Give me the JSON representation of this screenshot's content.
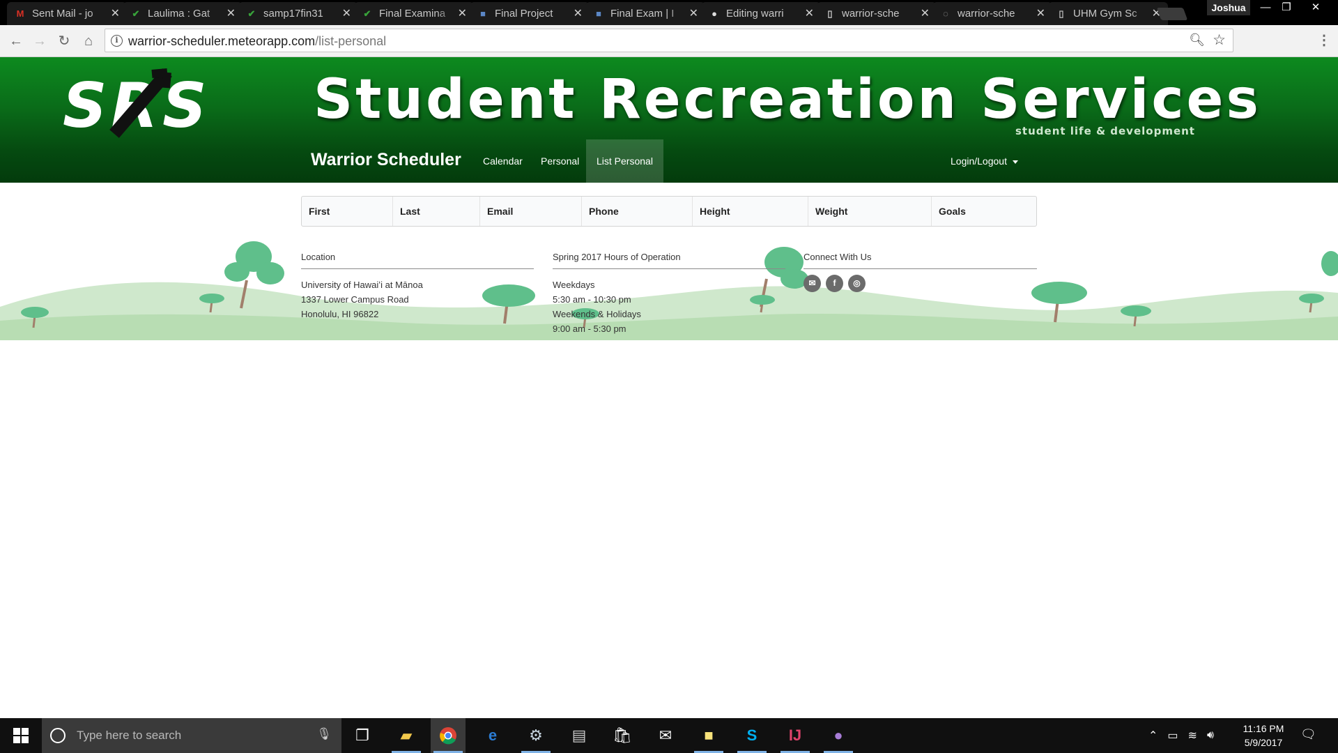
{
  "browser": {
    "tabs": [
      {
        "title": "Sent Mail - jo",
        "icon": "gmail-icon",
        "color": "#d93025",
        "glyph": "M"
      },
      {
        "title": "Laulima : Gat",
        "icon": "laulima-icon",
        "color": "#38a33a",
        "glyph": "✔"
      },
      {
        "title": "samp17fin31",
        "icon": "laulima-icon",
        "color": "#38a33a",
        "glyph": "✔"
      },
      {
        "title": "Final Examina",
        "icon": "laulima-icon",
        "color": "#38a33a",
        "glyph": "✔"
      },
      {
        "title": "Final Project",
        "icon": "doc-icon",
        "color": "#5b87c5",
        "glyph": "■"
      },
      {
        "title": "Final Exam | I",
        "icon": "doc-icon",
        "color": "#5b87c5",
        "glyph": "■"
      },
      {
        "title": "Editing warri",
        "icon": "github-icon",
        "color": "#dddddd",
        "glyph": "●"
      },
      {
        "title": "warrior-sche",
        "icon": "page-icon",
        "color": "#cccccc",
        "glyph": "▯"
      },
      {
        "title": "warrior-sche",
        "icon": "loading-icon",
        "color": "#aaaaaa",
        "glyph": "◌"
      },
      {
        "title": "UHM Gym Sc",
        "icon": "page-icon",
        "color": "#bbbbbb",
        "glyph": "▯"
      }
    ],
    "user": "Joshua",
    "url_host": "warrior-scheduler.meteorapp.com",
    "url_path": "/list-personal"
  },
  "banner": {
    "logo_text": "SRS",
    "title": "Student Recreation Services",
    "subtitle": "student life & development"
  },
  "nav": {
    "brand": "Warrior Scheduler",
    "links": [
      "Calendar",
      "Personal",
      "List Personal"
    ],
    "active": "List Personal",
    "login": "Login/Logout"
  },
  "table": {
    "columns": [
      "First",
      "Last",
      "Email",
      "Phone",
      "Height",
      "Weight",
      "Goals"
    ]
  },
  "footer": {
    "location": {
      "heading": "Location",
      "lines": [
        "University of Hawaiʻi at Mānoa",
        "1337 Lower Campus Road",
        "Honolulu, HI 96822"
      ]
    },
    "hours": {
      "heading": "Spring 2017 Hours of Operation",
      "lines": [
        "Weekdays",
        "5:30 am - 10:30 pm",
        "Weekends & Holidays",
        "9:00 am - 5:30 pm"
      ]
    },
    "connect": {
      "heading": "Connect With Us",
      "icons": [
        "email-icon",
        "facebook-icon",
        "instagram-icon"
      ]
    }
  },
  "taskbar": {
    "search_placeholder": "Type here to search",
    "time": "11:16 PM",
    "date": "5/9/2017"
  }
}
